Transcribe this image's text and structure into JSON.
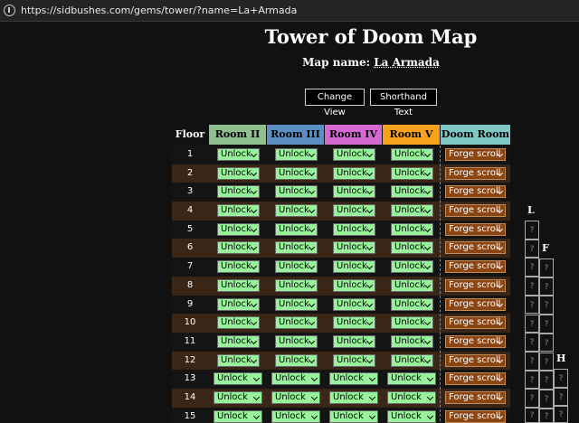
{
  "browser": {
    "url": "https://sidbushes.com/gems/tower/?name=La+Armada"
  },
  "page": {
    "title": "Tower of Doom Map",
    "map_name_label": "Map name:",
    "map_name": "La Armada",
    "buttons": {
      "change_view": "Change View",
      "shorthand_text": "Shorthand Text"
    }
  },
  "table": {
    "headers": {
      "floor": "Floor",
      "room2": "Room II",
      "room3": "Room III",
      "room4": "Room IV",
      "room5": "Room V",
      "doom": "Doom Room"
    },
    "header_colors": {
      "room2": "#8fbf8f",
      "room3": "#5b8fc4",
      "room4": "#d46ad1",
      "room5": "#f4a31b",
      "doom": "#7fc7c5"
    },
    "unlock_label": "Unlock",
    "doom_label": "Forge scroll",
    "floors": [
      "1",
      "2",
      "3",
      "4",
      "5",
      "6",
      "7",
      "8",
      "9",
      "10",
      "11",
      "12",
      "13",
      "14",
      "15"
    ]
  },
  "side_columns": [
    {
      "letter": "L",
      "cells": [
        "?",
        "?",
        "?",
        "?",
        "?",
        "?",
        "?",
        "?",
        "?",
        "?",
        "?"
      ]
    },
    {
      "letter": "F",
      "cells": [
        "?",
        "?",
        "?",
        "?",
        "?",
        "?",
        "?",
        "?",
        "?"
      ]
    },
    {
      "letter": "H",
      "cells": [
        "?",
        "?",
        "?"
      ]
    }
  ],
  "colors": {
    "unlock_bg": "#98f29b",
    "forge_bg": "#8b4512",
    "row_brown": "#3a2616",
    "page_bg": "#111111"
  }
}
